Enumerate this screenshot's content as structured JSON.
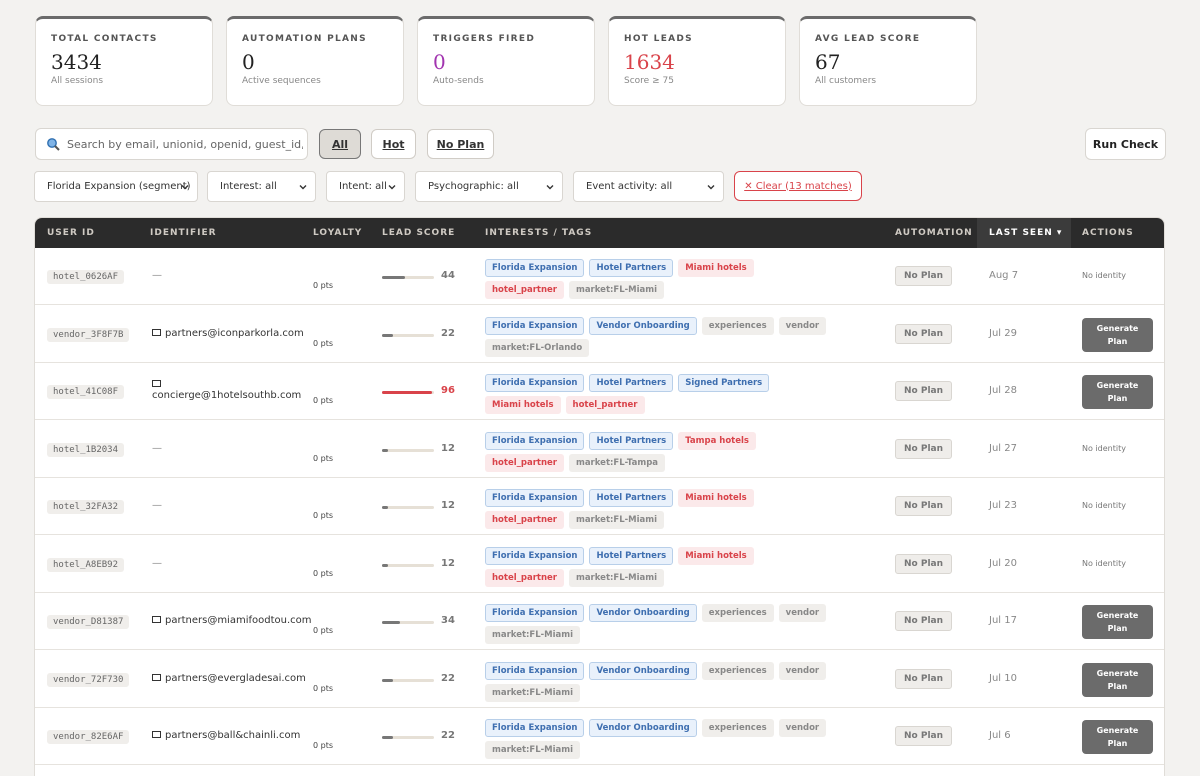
{
  "stats": [
    {
      "label": "TOTAL CONTACTS",
      "value": "3434",
      "sub": "All sessions"
    },
    {
      "label": "AUTOMATION PLANS",
      "value": "0",
      "sub": "Active sequences"
    },
    {
      "label": "TRIGGERS FIRED",
      "value": "0",
      "sub": "Auto-sends"
    },
    {
      "label": "HOT LEADS",
      "value": "1634",
      "sub": "Score ≥ 75"
    },
    {
      "label": "AVG LEAD SCORE",
      "value": "67",
      "sub": "All customers"
    }
  ],
  "search": {
    "placeholder": "Search by email, unionid, openid, guest_id, nam"
  },
  "quick_filters": [
    "All",
    "Hot",
    "No Plan"
  ],
  "run_check_label": "Run Check",
  "filters": {
    "segment": "Florida Expansion (segment)",
    "interest": "Interest: all",
    "intent": "Intent: all",
    "psychographic": "Psychographic: all",
    "event": "Event activity: all",
    "clear": "✕ Clear (13 matches)"
  },
  "columns": [
    "USER ID",
    "IDENTIFIER",
    "LOYALTY",
    "LEAD SCORE",
    "INTERESTS / TAGS",
    "AUTOMATION",
    "LAST SEEN ▾",
    "ACTIONS"
  ],
  "colors": {
    "accent_red": "#d9434a",
    "header_bg": "#2b2b2b",
    "purple": "#a234b0"
  },
  "rows": [
    {
      "user_id": "hotel_0626AF",
      "identifier": "—",
      "has_email": false,
      "loyalty": "0 pts",
      "score": 44,
      "score_label": "44",
      "tags": [
        {
          "t": "Florida Expansion",
          "c": "blue"
        },
        {
          "t": "Hotel Partners",
          "c": "blue"
        },
        {
          "t": "Miami hotels",
          "c": "red"
        },
        {
          "t": "hotel_partner",
          "c": "red"
        },
        {
          "t": "market:FL-Miami",
          "c": "gray"
        }
      ],
      "automation": "No Plan",
      "last_seen": "Aug 7",
      "action": "No identity"
    },
    {
      "user_id": "vendor_3F8F7B",
      "identifier": "partners@iconparkorla.com",
      "has_email": true,
      "loyalty": "0 pts",
      "score": 22,
      "score_label": "22",
      "tags": [
        {
          "t": "Florida Expansion",
          "c": "blue"
        },
        {
          "t": "Vendor Onboarding",
          "c": "blue"
        },
        {
          "t": "experiences",
          "c": "gray"
        },
        {
          "t": "vendor",
          "c": "gray"
        },
        {
          "t": "market:FL-Orlando",
          "c": "gray"
        }
      ],
      "automation": "No Plan",
      "last_seen": "Jul 29",
      "action": "Generate Plan"
    },
    {
      "user_id": "hotel_41C08F",
      "identifier": "concierge@1hotelsouthb.com",
      "has_email": true,
      "wrap": true,
      "loyalty": "0 pts",
      "score": 96,
      "score_label": "96",
      "hot": true,
      "tags": [
        {
          "t": "Florida Expansion",
          "c": "blue"
        },
        {
          "t": "Hotel Partners",
          "c": "blue"
        },
        {
          "t": "Signed Partners",
          "c": "blue"
        },
        {
          "t": "Miami hotels",
          "c": "red"
        },
        {
          "t": "hotel_partner",
          "c": "red"
        }
      ],
      "automation": "No Plan",
      "last_seen": "Jul 28",
      "action": "Generate Plan"
    },
    {
      "user_id": "hotel_1B2034",
      "identifier": "—",
      "has_email": false,
      "loyalty": "0 pts",
      "score": 12,
      "score_label": "12",
      "tags": [
        {
          "t": "Florida Expansion",
          "c": "blue"
        },
        {
          "t": "Hotel Partners",
          "c": "blue"
        },
        {
          "t": "Tampa hotels",
          "c": "red"
        },
        {
          "t": "hotel_partner",
          "c": "red"
        },
        {
          "t": "market:FL-Tampa",
          "c": "gray"
        }
      ],
      "automation": "No Plan",
      "last_seen": "Jul 27",
      "action": "No identity"
    },
    {
      "user_id": "hotel_32FA32",
      "identifier": "—",
      "has_email": false,
      "loyalty": "0 pts",
      "score": 12,
      "score_label": "12",
      "tags": [
        {
          "t": "Florida Expansion",
          "c": "blue"
        },
        {
          "t": "Hotel Partners",
          "c": "blue"
        },
        {
          "t": "Miami hotels",
          "c": "red"
        },
        {
          "t": "hotel_partner",
          "c": "red"
        },
        {
          "t": "market:FL-Miami",
          "c": "gray"
        }
      ],
      "automation": "No Plan",
      "last_seen": "Jul 23",
      "action": "No identity"
    },
    {
      "user_id": "hotel_A8EB92",
      "identifier": "—",
      "has_email": false,
      "loyalty": "0 pts",
      "score": 12,
      "score_label": "12",
      "tags": [
        {
          "t": "Florida Expansion",
          "c": "blue"
        },
        {
          "t": "Hotel Partners",
          "c": "blue"
        },
        {
          "t": "Miami hotels",
          "c": "red"
        },
        {
          "t": "hotel_partner",
          "c": "red"
        },
        {
          "t": "market:FL-Miami",
          "c": "gray"
        }
      ],
      "automation": "No Plan",
      "last_seen": "Jul 20",
      "action": "No identity"
    },
    {
      "user_id": "vendor_D81387",
      "identifier": "partners@miamifoodtou.com",
      "has_email": true,
      "loyalty": "0 pts",
      "score": 34,
      "score_label": "34",
      "tags": [
        {
          "t": "Florida Expansion",
          "c": "blue"
        },
        {
          "t": "Vendor Onboarding",
          "c": "blue"
        },
        {
          "t": "experiences",
          "c": "gray"
        },
        {
          "t": "vendor",
          "c": "gray"
        },
        {
          "t": "market:FL-Miami",
          "c": "gray"
        }
      ],
      "automation": "No Plan",
      "last_seen": "Jul 17",
      "action": "Generate Plan"
    },
    {
      "user_id": "vendor_72F730",
      "identifier": "partners@evergladesai.com",
      "has_email": true,
      "loyalty": "0 pts",
      "score": 22,
      "score_label": "22",
      "tags": [
        {
          "t": "Florida Expansion",
          "c": "blue"
        },
        {
          "t": "Vendor Onboarding",
          "c": "blue"
        },
        {
          "t": "experiences",
          "c": "gray"
        },
        {
          "t": "vendor",
          "c": "gray"
        },
        {
          "t": "market:FL-Miami",
          "c": "gray"
        }
      ],
      "automation": "No Plan",
      "last_seen": "Jul 10",
      "action": "Generate Plan"
    },
    {
      "user_id": "vendor_82E6AF",
      "identifier": "partners@ball&chainli.com",
      "has_email": true,
      "loyalty": "0 pts",
      "score": 22,
      "score_label": "22",
      "tags": [
        {
          "t": "Florida Expansion",
          "c": "blue"
        },
        {
          "t": "Vendor Onboarding",
          "c": "blue"
        },
        {
          "t": "experiences",
          "c": "gray"
        },
        {
          "t": "vendor",
          "c": "gray"
        },
        {
          "t": "market:FL-Miami",
          "c": "gray"
        }
      ],
      "automation": "No Plan",
      "last_seen": "Jul 6",
      "action": "Generate Plan"
    }
  ]
}
